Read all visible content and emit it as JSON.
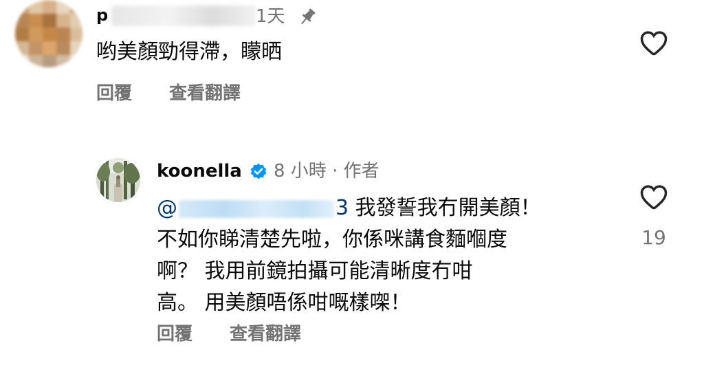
{
  "comments": [
    {
      "username_visible": "p",
      "time": "1天",
      "pinned": true,
      "text": "哟美顏勁得滯，矇晒",
      "reply_label": "回覆",
      "translate_label": "查看翻譯",
      "liked": false
    },
    {
      "username": "koonella",
      "verified": true,
      "meta": "8 小時 · 作者",
      "mention_prefix": "@",
      "mention_suffix": "3",
      "line1_text": " 我發誓我冇開美顏！",
      "line2": "不如你睇清楚先啦，你係咪講食麵嗰度",
      "line3": "啊？ 我用前鏡拍攝可能清晰度冇咁",
      "line4": "高。 用美顏唔係咁嘅樣㗎！",
      "reply_label": "回覆",
      "translate_label": "查看翻譯",
      "like_count": "19",
      "liked": false
    }
  ],
  "colors": {
    "text_primary": "#0a0a0a",
    "text_secondary": "#737373",
    "verified_blue": "#0095f6",
    "mention": "#00376b"
  },
  "icons": [
    "pin-icon",
    "heart-icon",
    "verified-badge-icon"
  ]
}
